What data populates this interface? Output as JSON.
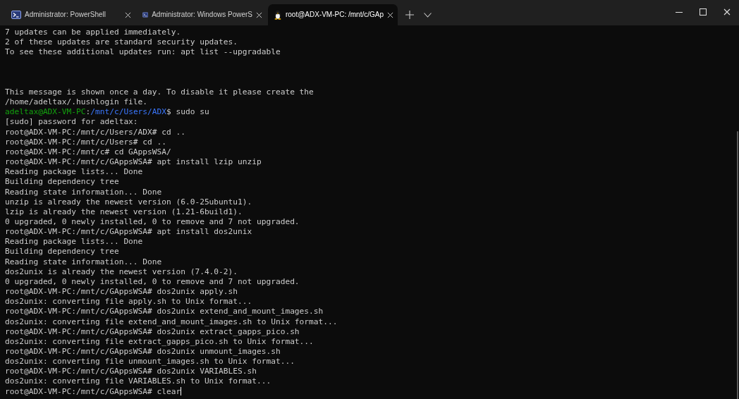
{
  "tabs": [
    {
      "title": "Administrator: PowerShell",
      "kind": "powershell",
      "selected": false
    },
    {
      "title": "Administrator: Windows PowerS",
      "kind": "powershell",
      "selected": false
    },
    {
      "title": "root@ADX-VM-PC: /mnt/c/GAp",
      "kind": "linux",
      "selected": true
    }
  ],
  "terminal": {
    "lines": [
      {
        "kind": "text",
        "text": "7 updates can be applied immediately."
      },
      {
        "kind": "text",
        "text": "2 of these updates are standard security updates."
      },
      {
        "kind": "text",
        "text": "To see these additional updates run: apt list --upgradable"
      },
      {
        "kind": "blank"
      },
      {
        "kind": "blank"
      },
      {
        "kind": "blank"
      },
      {
        "kind": "text",
        "text": "This message is shown once a day. To disable it please create the"
      },
      {
        "kind": "text",
        "text": "/home/adeltax/.hushlogin file."
      },
      {
        "kind": "prompt",
        "user": "adeltax@ADX-VM-PC",
        "separator": ":",
        "path": "/mnt/c/Users/ADX",
        "symbol": "$",
        "command": "sudo su"
      },
      {
        "kind": "text",
        "text": "[sudo] password for adeltax:"
      },
      {
        "kind": "text",
        "text": "root@ADX-VM-PC:/mnt/c/Users/ADX# cd .."
      },
      {
        "kind": "text",
        "text": "root@ADX-VM-PC:/mnt/c/Users# cd .."
      },
      {
        "kind": "text",
        "text": "root@ADX-VM-PC:/mnt/c# cd GAppsWSA/"
      },
      {
        "kind": "text",
        "text": "root@ADX-VM-PC:/mnt/c/GAppsWSA# apt install lzip unzip"
      },
      {
        "kind": "text",
        "text": "Reading package lists... Done"
      },
      {
        "kind": "text",
        "text": "Building dependency tree"
      },
      {
        "kind": "text",
        "text": "Reading state information... Done"
      },
      {
        "kind": "text",
        "text": "unzip is already the newest version (6.0-25ubuntu1)."
      },
      {
        "kind": "text",
        "text": "lzip is already the newest version (1.21-6build1)."
      },
      {
        "kind": "text",
        "text": "0 upgraded, 0 newly installed, 0 to remove and 7 not upgraded."
      },
      {
        "kind": "text",
        "text": "root@ADX-VM-PC:/mnt/c/GAppsWSA# apt install dos2unix"
      },
      {
        "kind": "text",
        "text": "Reading package lists... Done"
      },
      {
        "kind": "text",
        "text": "Building dependency tree"
      },
      {
        "kind": "text",
        "text": "Reading state information... Done"
      },
      {
        "kind": "text",
        "text": "dos2unix is already the newest version (7.4.0-2)."
      },
      {
        "kind": "text",
        "text": "0 upgraded, 0 newly installed, 0 to remove and 7 not upgraded."
      },
      {
        "kind": "text",
        "text": "root@ADX-VM-PC:/mnt/c/GAppsWSA# dos2unix apply.sh"
      },
      {
        "kind": "text",
        "text": "dos2unix: converting file apply.sh to Unix format..."
      },
      {
        "kind": "text",
        "text": "root@ADX-VM-PC:/mnt/c/GAppsWSA# dos2unix extend_and_mount_images.sh"
      },
      {
        "kind": "text",
        "text": "dos2unix: converting file extend_and_mount_images.sh to Unix format..."
      },
      {
        "kind": "text",
        "text": "root@ADX-VM-PC:/mnt/c/GAppsWSA# dos2unix extract_gapps_pico.sh"
      },
      {
        "kind": "text",
        "text": "dos2unix: converting file extract_gapps_pico.sh to Unix format..."
      },
      {
        "kind": "text",
        "text": "root@ADX-VM-PC:/mnt/c/GAppsWSA# dos2unix unmount_images.sh"
      },
      {
        "kind": "text",
        "text": "dos2unix: converting file unmount_images.sh to Unix format..."
      },
      {
        "kind": "text",
        "text": "root@ADX-VM-PC:/mnt/c/GAppsWSA# dos2unix VARIABLES.sh"
      },
      {
        "kind": "text",
        "text": "dos2unix: converting file VARIABLES.sh to Unix format..."
      },
      {
        "kind": "text",
        "text": "root@ADX-VM-PC:/mnt/c/GAppsWSA# clear",
        "cursor": true
      }
    ]
  }
}
